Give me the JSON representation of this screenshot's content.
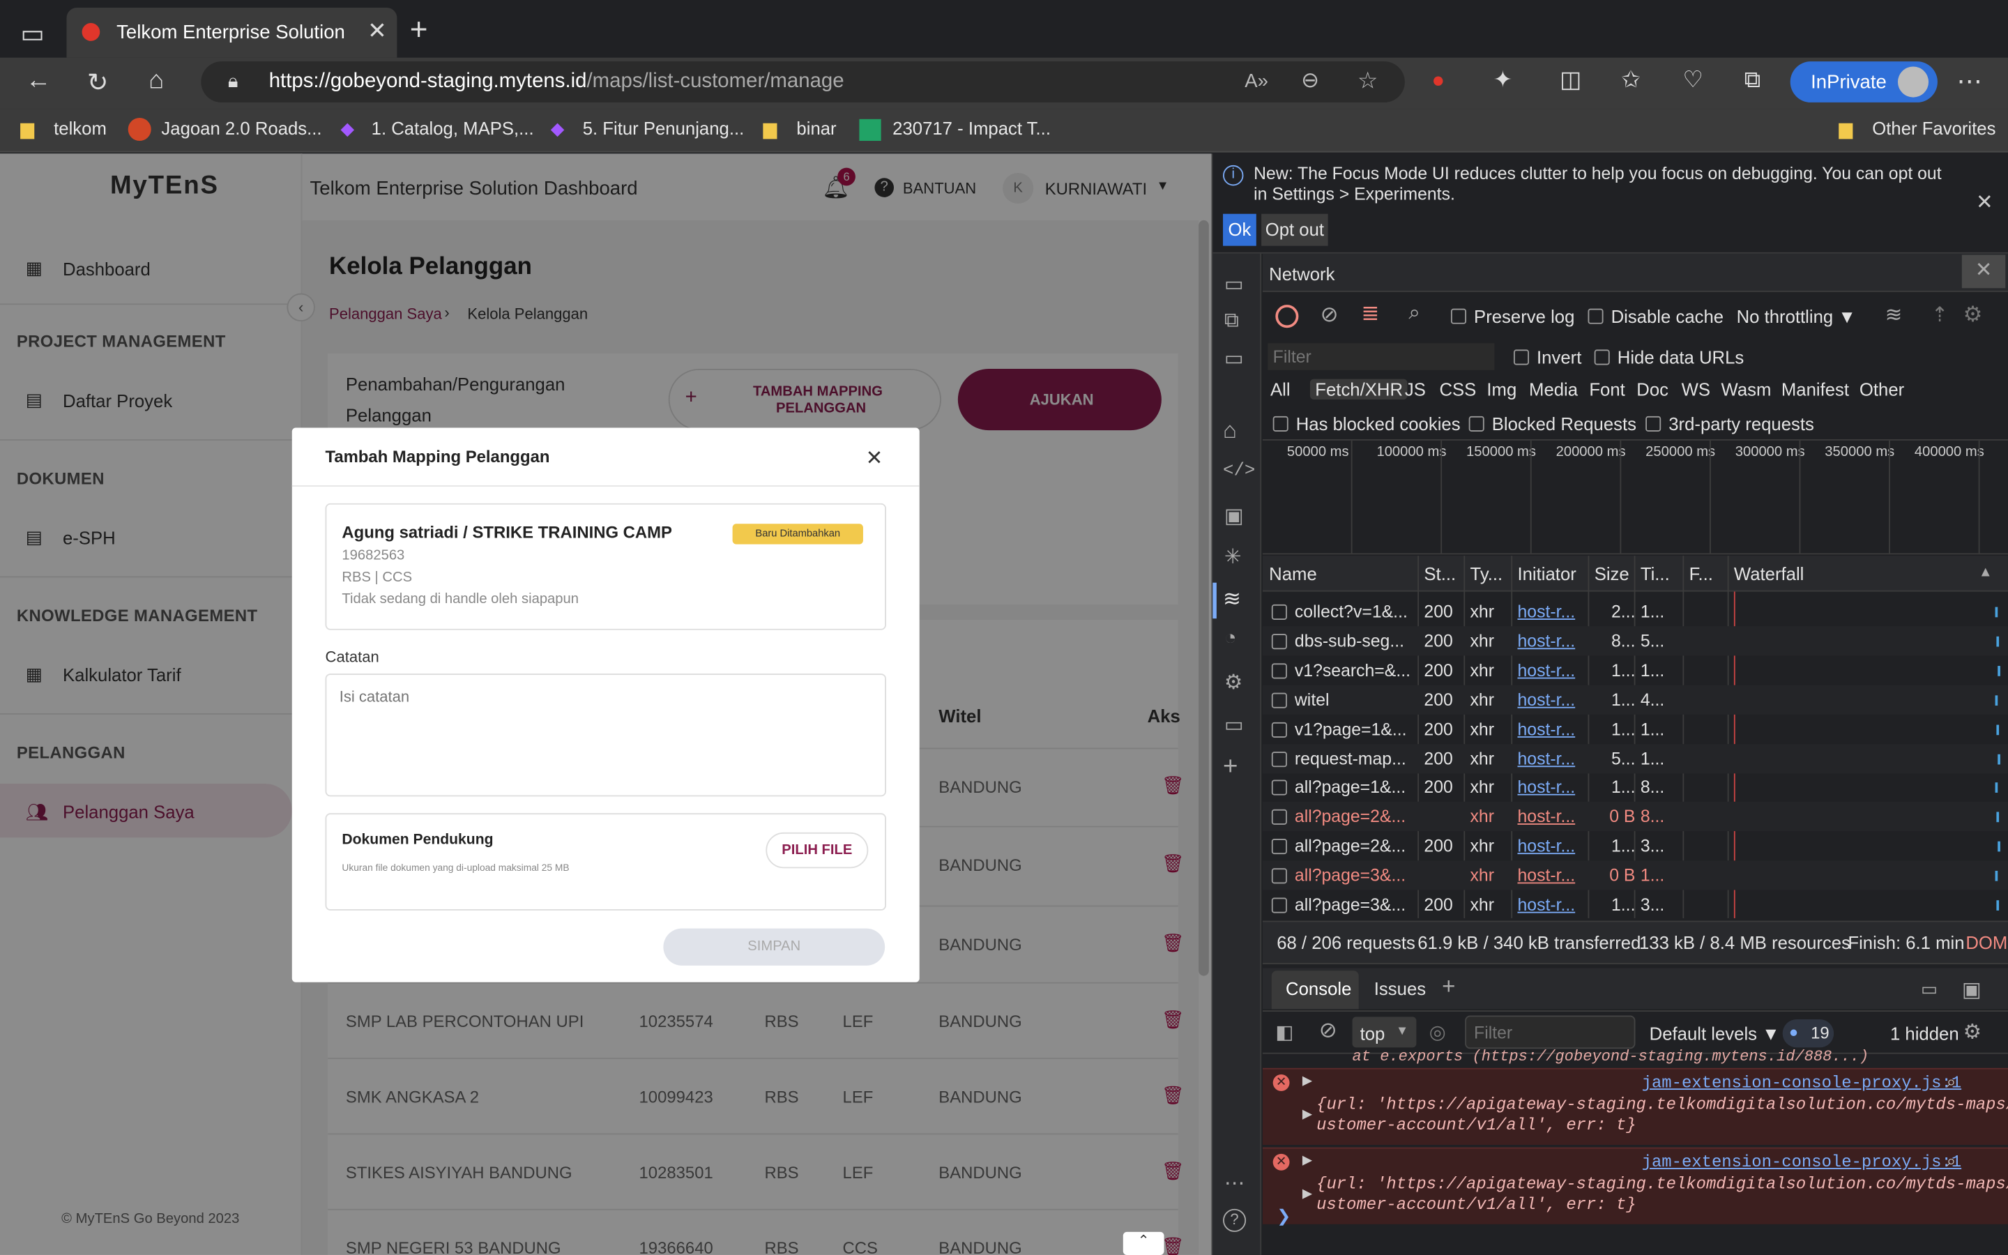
{
  "browser": {
    "tab_title": "Telkom Enterprise Solution",
    "url_host": "https://gobeyond-staging.mytens.id",
    "url_path": "/maps/list-customer/manage",
    "inprivate_label": "InPrivate",
    "bookmarks": [
      "telkom",
      "Jagoan 2.0 Roads...",
      "1. Catalog, MAPS,...",
      "5. Fitur Penunjang...",
      "binar",
      "230717 - Impact T...",
      "Other Favorites"
    ]
  },
  "app": {
    "logo": "MyTEnS",
    "header_title": "Telkom Enterprise Solution Dashboard",
    "notif_count": "6",
    "help_label": "BANTUAN",
    "avatar_letter": "K",
    "user_name": "KURNIAWATI",
    "sidebar": {
      "dashboard": "Dashboard",
      "sec_pm": "PROJECT MANAGEMENT",
      "daftar_proyek": "Daftar Proyek",
      "sec_dok": "DOKUMEN",
      "esph": "e-SPH",
      "sec_km": "KNOWLEDGE MANAGEMENT",
      "kalkulator": "Kalkulator Tarif",
      "sec_pel": "PELANGGAN",
      "pelanggan_saya": "Pelanggan Saya",
      "footer": "© MyTEnS Go Beyond 2023"
    },
    "page_title": "Kelola Pelanggan",
    "breadcrumb_root": "Pelanggan Saya",
    "breadcrumb_current": "Kelola Pelanggan",
    "card_title_1": "Penambahan/Pengurangan",
    "card_title_2": "Pelanggan",
    "btn_tambah_1": "TAMBAH MAPPING",
    "btn_tambah_2": "PELANGGAN",
    "btn_ajukan": "AJUKAN",
    "table": {
      "col_witel": "Witel",
      "col_aksi": "Aks",
      "rows": [
        {
          "name": "",
          "id": "",
          "seg": "",
          "type": "",
          "witel": "BANDUNG"
        },
        {
          "name": "",
          "id": "",
          "seg": "",
          "type": "",
          "witel": "BANDUNG"
        },
        {
          "name": "",
          "id": "",
          "seg": "",
          "type": "",
          "witel": "BANDUNG"
        },
        {
          "name": "SMP LAB PERCONTOHAN UPI",
          "id": "10235574",
          "seg": "RBS",
          "type": "LEF",
          "witel": "BANDUNG"
        },
        {
          "name": "SMK ANGKASA 2",
          "id": "10099423",
          "seg": "RBS",
          "type": "LEF",
          "witel": "BANDUNG"
        },
        {
          "name": "STIKES AISYIYAH BANDUNG",
          "id": "10283501",
          "seg": "RBS",
          "type": "LEF",
          "witel": "BANDUNG"
        },
        {
          "name": "SMP NEGERI 53 BANDUNG",
          "id": "19366640",
          "seg": "RBS",
          "type": "CCS",
          "witel": "BANDUNG"
        }
      ]
    },
    "modal": {
      "title": "Tambah Mapping Pelanggan",
      "customer_name": "Agung satriadi / STRIKE TRAINING CAMP",
      "badge": "Baru Ditambahkan",
      "customer_id": "19682563",
      "customer_seg": "RBS | CCS",
      "customer_status": "Tidak sedang di handle oleh siapapun",
      "catatan_label": "Catatan",
      "catatan_placeholder": "Isi catatan",
      "dok_label": "Dokumen Pendukung",
      "dok_hint": "Ukuran file dokumen yang di-upload maksimal 25 MB",
      "pilih_file": "PILIH FILE",
      "simpan": "SIMPAN"
    }
  },
  "devtools": {
    "banner": "New: The Focus Mode UI reduces clutter to help you focus on debugging. You can opt out in Settings > Experiments.",
    "ok": "Ok",
    "opt_out": "Opt out",
    "panel_title": "Network",
    "preserve_log": "Preserve log",
    "disable_cache": "Disable cache",
    "throttling": "No throttling",
    "filter_placeholder": "Filter",
    "invert": "Invert",
    "hide_data_urls": "Hide data URLs",
    "types": [
      "All",
      "Fetch/XHR",
      "JS",
      "CSS",
      "Img",
      "Media",
      "Font",
      "Doc",
      "WS",
      "Wasm",
      "Manifest",
      "Other"
    ],
    "has_blocked": "Has blocked cookies",
    "blocked_req": "Blocked Requests",
    "third_party": "3rd-party requests",
    "timeline_ticks": [
      "50000 ms",
      "100000 ms",
      "150000 ms",
      "200000 ms",
      "250000 ms",
      "300000 ms",
      "350000 ms",
      "400000 ms"
    ],
    "columns": [
      "Name",
      "St...",
      "Ty...",
      "Initiator",
      "Size",
      "Ti...",
      "F...",
      "Waterfall"
    ],
    "rows": [
      {
        "name": "collect?v=1&...",
        "status": "200",
        "type": "xhr",
        "init": "host-r...",
        "size": "2...",
        "time": "1...",
        "err": false
      },
      {
        "name": "dbs-sub-seg...",
        "status": "200",
        "type": "xhr",
        "init": "host-r...",
        "size": "8...",
        "time": "5...",
        "err": false
      },
      {
        "name": "v1?search=&...",
        "status": "200",
        "type": "xhr",
        "init": "host-r...",
        "size": "1...",
        "time": "1...",
        "err": false
      },
      {
        "name": "witel",
        "status": "200",
        "type": "xhr",
        "init": "host-r...",
        "size": "1...",
        "time": "4...",
        "err": false
      },
      {
        "name": "v1?page=1&...",
        "status": "200",
        "type": "xhr",
        "init": "host-r...",
        "size": "1...",
        "time": "1...",
        "err": false
      },
      {
        "name": "request-map...",
        "status": "200",
        "type": "xhr",
        "init": "host-r...",
        "size": "5...",
        "time": "1...",
        "err": false
      },
      {
        "name": "all?page=1&...",
        "status": "200",
        "type": "xhr",
        "init": "host-r...",
        "size": "1...",
        "time": "8...",
        "err": false
      },
      {
        "name": "all?page=2&...",
        "status": "",
        "type": "xhr",
        "init": "host-r...",
        "size": "0 B",
        "time": "8...",
        "err": true
      },
      {
        "name": "all?page=2&...",
        "status": "200",
        "type": "xhr",
        "init": "host-r...",
        "size": "1...",
        "time": "3...",
        "err": false
      },
      {
        "name": "all?page=3&...",
        "status": "",
        "type": "xhr",
        "init": "host-r...",
        "size": "0 B",
        "time": "1...",
        "err": true
      },
      {
        "name": "all?page=3&...",
        "status": "200",
        "type": "xhr",
        "init": "host-r...",
        "size": "1...",
        "time": "3...",
        "err": false
      }
    ],
    "summary": {
      "requests": "68 / 206 requests",
      "transferred": "61.9 kB / 340 kB transferred",
      "resources": "133 kB / 8.4 MB resources",
      "finish": "Finish: 6.1 min",
      "dom": "DOMC"
    },
    "console_tab": "Console",
    "issues_tab": "Issues",
    "context": "top",
    "console_filter": "Filter",
    "levels": "Default levels",
    "msg_count": "19",
    "hidden": "1 hidden",
    "console_prev": "at e.exports (https://gobeyond-staging.mytens.id/888...)",
    "errors": [
      {
        "source": "jam-extension-console-proxy.js:1",
        "line1": "{url: 'https://apigateway-staging.telkomdigitalsolution.co/mytds-maps/c",
        "line2": "ustomer-account/v1/all', err: t}"
      },
      {
        "source": "jam-extension-console-proxy.js:1",
        "line1": "{url: 'https://apigateway-staging.telkomdigitalsolution.co/mytds-maps/c",
        "line2": "ustomer-account/v1/all', err: t}"
      }
    ]
  }
}
